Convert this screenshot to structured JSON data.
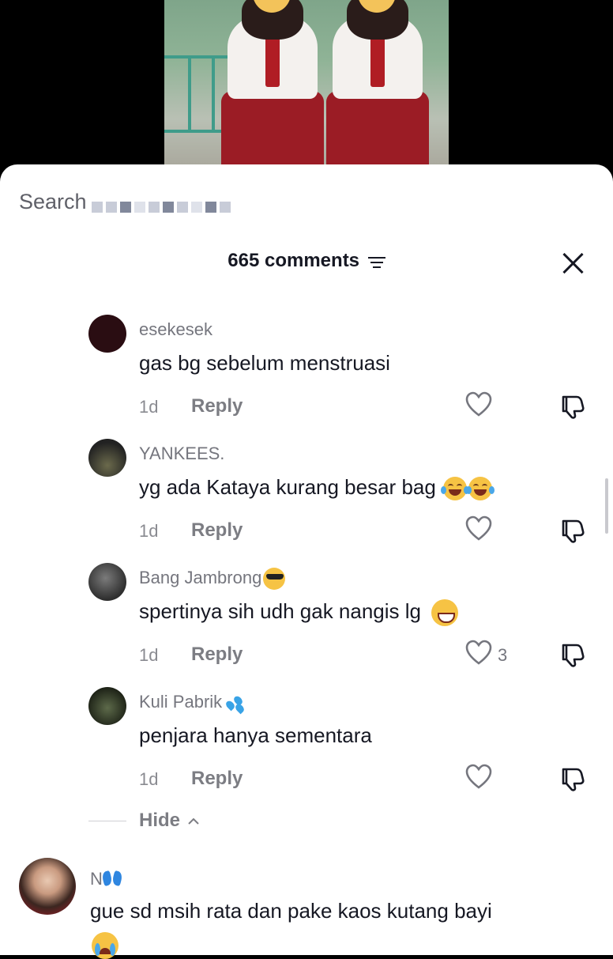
{
  "search": {
    "label": "Search"
  },
  "header": {
    "title": "665 comments"
  },
  "comments": [
    {
      "user": "esekesek",
      "text": "gas bg sebelum menstruasi",
      "time": "1d",
      "reply": "Reply",
      "likes": ""
    },
    {
      "user": "YANKEES.",
      "text": "yg ada Kataya kurang besar bag",
      "time": "1d",
      "reply": "Reply",
      "likes": ""
    },
    {
      "user": "Bang Jambrong",
      "text": "spertinya sih udh gak nangis lg",
      "time": "1d",
      "reply": "Reply",
      "likes": "3"
    },
    {
      "user": "Kuli Pabrik",
      "text": "penjara hanya sementara",
      "time": "1d",
      "reply": "Reply",
      "likes": ""
    }
  ],
  "hide": {
    "label": "Hide"
  },
  "top_comment": {
    "user": "N",
    "text": "gue sd msih rata dan pake kaos kutang bayi"
  },
  "colors": {
    "text": "#161823",
    "muted": "#75767e",
    "sheet": "#ffffff"
  }
}
